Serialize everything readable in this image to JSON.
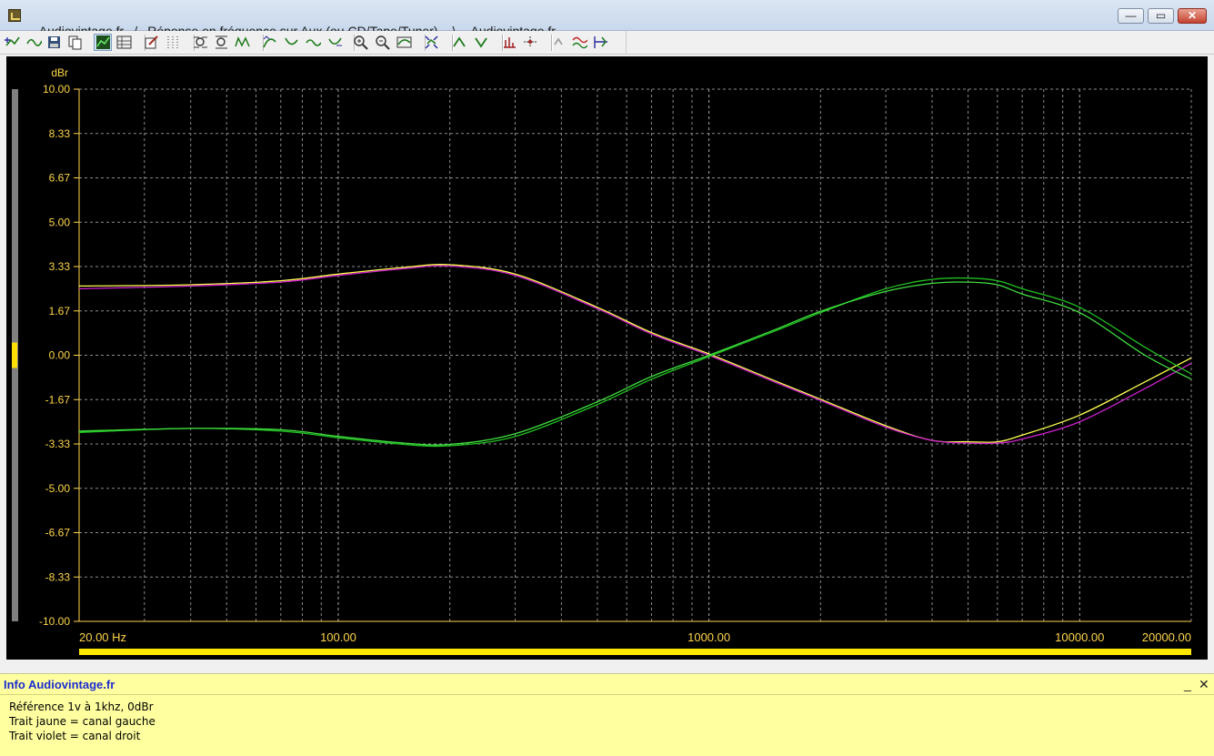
{
  "window": {
    "title_segments": [
      "Audiovintage.fr",
      "/",
      "Réponse en fréquence sur Aux (ou CD/Tape/Tuner)",
      "\\",
      "Audiovintage.fr"
    ],
    "minimize_symbol": "—",
    "maximize_symbol": "▭",
    "close_symbol": "✕"
  },
  "toolbar": {
    "buttons": [
      {
        "icon": "add-curve-icon",
        "active": false
      },
      {
        "icon": "wave-icon",
        "active": false
      },
      {
        "icon": "save-icon",
        "active": false
      },
      {
        "icon": "copy-icon",
        "active": false
      },
      {
        "icon": "graph-view-icon",
        "active": true
      },
      {
        "icon": "settings-grid-icon",
        "active": false
      },
      {
        "icon": "edit-icon",
        "active": false
      },
      {
        "icon": "dotted-grid-icon",
        "active": false
      },
      {
        "icon": "zoom-x-icon",
        "active": false
      },
      {
        "icon": "zoom-y-icon",
        "active": false
      },
      {
        "icon": "signal-icon",
        "active": false
      },
      {
        "icon": "curve-up-icon",
        "active": false
      },
      {
        "icon": "curve-down-icon",
        "active": false
      },
      {
        "icon": "curve-shift-icon",
        "active": false
      },
      {
        "icon": "curve-reset-icon",
        "active": false
      },
      {
        "icon": "zoom-in-icon",
        "active": false
      },
      {
        "icon": "zoom-out-icon",
        "active": false
      },
      {
        "icon": "autoscale-icon",
        "active": false
      },
      {
        "icon": "fit-icon",
        "active": false
      },
      {
        "icon": "arrow-up-icon",
        "active": false
      },
      {
        "icon": "arrow-down-icon",
        "active": false
      },
      {
        "icon": "measure-icon",
        "active": false
      },
      {
        "icon": "marker-icon",
        "active": false
      },
      {
        "icon": "undo-icon",
        "active": false
      },
      {
        "icon": "compare-icon",
        "active": false
      },
      {
        "icon": "cursor-icon",
        "active": false
      }
    ]
  },
  "chart_data": {
    "type": "line",
    "ylabel": "dBr",
    "x_scale": "log",
    "xlim": [
      20,
      20000
    ],
    "ylim": [
      -10,
      10
    ],
    "y_ticks": [
      "10.00",
      "8.33",
      "6.67",
      "5.00",
      "3.33",
      "1.67",
      "0.00",
      "-1.67",
      "-3.33",
      "-5.00",
      "-6.67",
      "-8.33",
      "-10.00"
    ],
    "x_tick_labels": [
      {
        "value": 20,
        "label": "20.00 Hz"
      },
      {
        "value": 100,
        "label": "100.00"
      },
      {
        "value": 1000,
        "label": "1000.00"
      },
      {
        "value": 10000,
        "label": "10000.00"
      },
      {
        "value": 20000,
        "label": "20000.00"
      }
    ],
    "grid": true,
    "series": [
      {
        "color": "#ffff50",
        "x": [
          20,
          40,
          70,
          100,
          150,
          200,
          300,
          500,
          700,
          1000,
          1500,
          2000,
          3000,
          4000,
          5000,
          6000,
          7000,
          10000,
          15000,
          20000
        ],
        "y": [
          2.6,
          2.65,
          2.8,
          3.05,
          3.3,
          3.4,
          3.05,
          1.8,
          0.85,
          0.05,
          -0.95,
          -1.65,
          -2.65,
          -3.2,
          -3.25,
          -3.25,
          -3.0,
          -2.25,
          -1.0,
          -0.1
        ]
      },
      {
        "color": "#d020d0",
        "x": [
          20,
          40,
          70,
          100,
          150,
          200,
          300,
          500,
          700,
          1000,
          1500,
          2000,
          3000,
          4000,
          5000,
          6000,
          7000,
          10000,
          15000,
          20000
        ],
        "y": [
          2.5,
          2.6,
          2.75,
          3.0,
          3.25,
          3.35,
          3.0,
          1.75,
          0.8,
          0.0,
          -1.0,
          -1.7,
          -2.7,
          -3.2,
          -3.3,
          -3.3,
          -3.15,
          -2.5,
          -1.25,
          -0.3
        ]
      },
      {
        "color": "#20c020",
        "x": [
          20,
          40,
          70,
          100,
          150,
          200,
          300,
          500,
          700,
          1000,
          1500,
          2000,
          3000,
          4000,
          5000,
          6000,
          7000,
          10000,
          15000,
          20000
        ],
        "y": [
          -2.9,
          -2.75,
          -2.85,
          -3.1,
          -3.35,
          -3.4,
          -3.05,
          -1.85,
          -0.9,
          -0.05,
          0.9,
          1.6,
          2.5,
          2.85,
          2.9,
          2.8,
          2.5,
          1.8,
          0.3,
          -0.7
        ]
      },
      {
        "color": "#40e040",
        "x": [
          20,
          40,
          70,
          100,
          150,
          200,
          300,
          500,
          700,
          1000,
          1500,
          2000,
          3000,
          4000,
          5000,
          6000,
          7000,
          10000,
          15000,
          20000
        ],
        "y": [
          -2.85,
          -2.75,
          -2.8,
          -3.05,
          -3.3,
          -3.35,
          -2.95,
          -1.75,
          -0.8,
          0.0,
          0.95,
          1.65,
          2.4,
          2.7,
          2.75,
          2.65,
          2.3,
          1.6,
          0.0,
          -0.9
        ]
      }
    ]
  },
  "info": {
    "header": "Info Audiovintage.fr",
    "lines": [
      "Référence 1v à 1khz, 0dBr",
      "Trait jaune = canal gauche",
      "Trait violet = canal droit"
    ],
    "minimize_symbol": "_",
    "close_symbol": "✕"
  }
}
